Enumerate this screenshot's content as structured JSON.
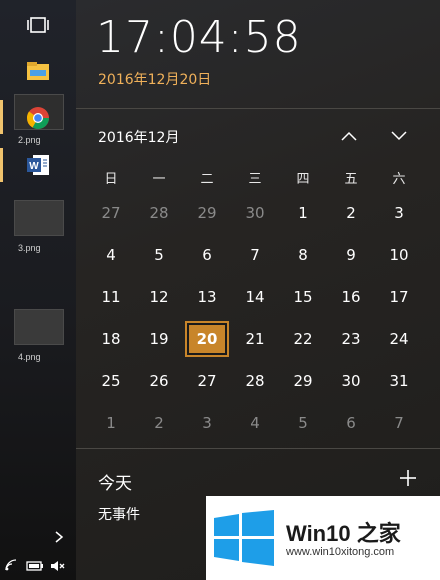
{
  "taskbar": {
    "thumbnails": [
      {
        "label": "2.png"
      },
      {
        "label": "3.png"
      },
      {
        "label": "4.png"
      }
    ],
    "icons": [
      "task-view-icon",
      "file-explorer-icon",
      "chrome-icon",
      "word-icon"
    ]
  },
  "clock": {
    "time": "17:04:58",
    "date": "2016年12月20日",
    "accent_color": "#f0b15a"
  },
  "calendar": {
    "month_label": "2016年12月",
    "weekdays": [
      "日",
      "一",
      "二",
      "三",
      "四",
      "五",
      "六"
    ],
    "weeks": [
      [
        "27",
        "28",
        "29",
        "30",
        "1",
        "2",
        "3"
      ],
      [
        "4",
        "5",
        "6",
        "7",
        "8",
        "9",
        "10"
      ],
      [
        "11",
        "12",
        "13",
        "14",
        "15",
        "16",
        "17"
      ],
      [
        "18",
        "19",
        "20",
        "21",
        "22",
        "23",
        "24"
      ],
      [
        "25",
        "26",
        "27",
        "28",
        "29",
        "30",
        "31"
      ],
      [
        "1",
        "2",
        "3",
        "4",
        "5",
        "6",
        "7"
      ]
    ],
    "selected_day": "20",
    "selected_color": "#c8852a"
  },
  "agenda": {
    "title": "今天",
    "empty_text": "无事件"
  },
  "watermark": {
    "brand": "Win10 之家",
    "url": "www.win10xitong.com"
  }
}
